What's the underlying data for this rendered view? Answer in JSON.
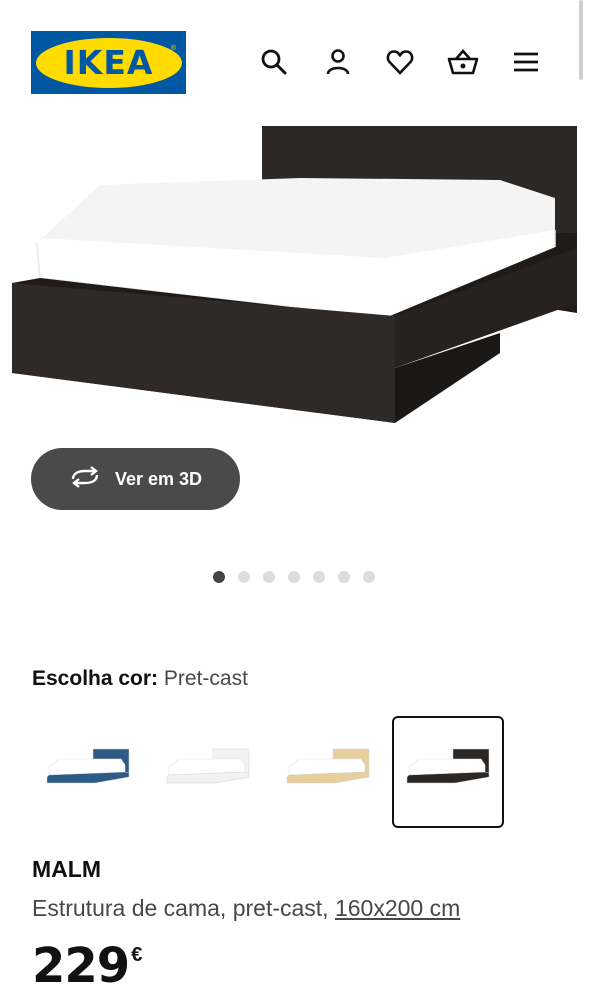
{
  "header": {
    "logo_text": "IKEA",
    "logo_reg": "®",
    "icons": [
      "search-icon",
      "user-icon",
      "heart-icon",
      "basket-icon",
      "menu-icon"
    ]
  },
  "colors": {
    "brand_blue": "#0058a3",
    "brand_yellow": "#ffdb00",
    "button_dark": "#4a4a4a"
  },
  "view3d": {
    "label": "Ver em 3D"
  },
  "gallery": {
    "total": 7,
    "active_index": 0
  },
  "color_choice": {
    "label": "Escolha cor:",
    "value": "Pret-cast"
  },
  "swatches": [
    {
      "name": "blue",
      "headboard": "#2e5b86",
      "selected": false
    },
    {
      "name": "white",
      "headboard": "#f2f2f2",
      "selected": false
    },
    {
      "name": "oak",
      "headboard": "#e6cf9c",
      "selected": false
    },
    {
      "name": "black-brown",
      "headboard": "#2b2724",
      "selected": true
    }
  ],
  "product": {
    "name": "MALM",
    "description": "Estrutura de cama, pret-cast,",
    "size_link": "160x200 cm",
    "price": "229",
    "currency": "€"
  }
}
